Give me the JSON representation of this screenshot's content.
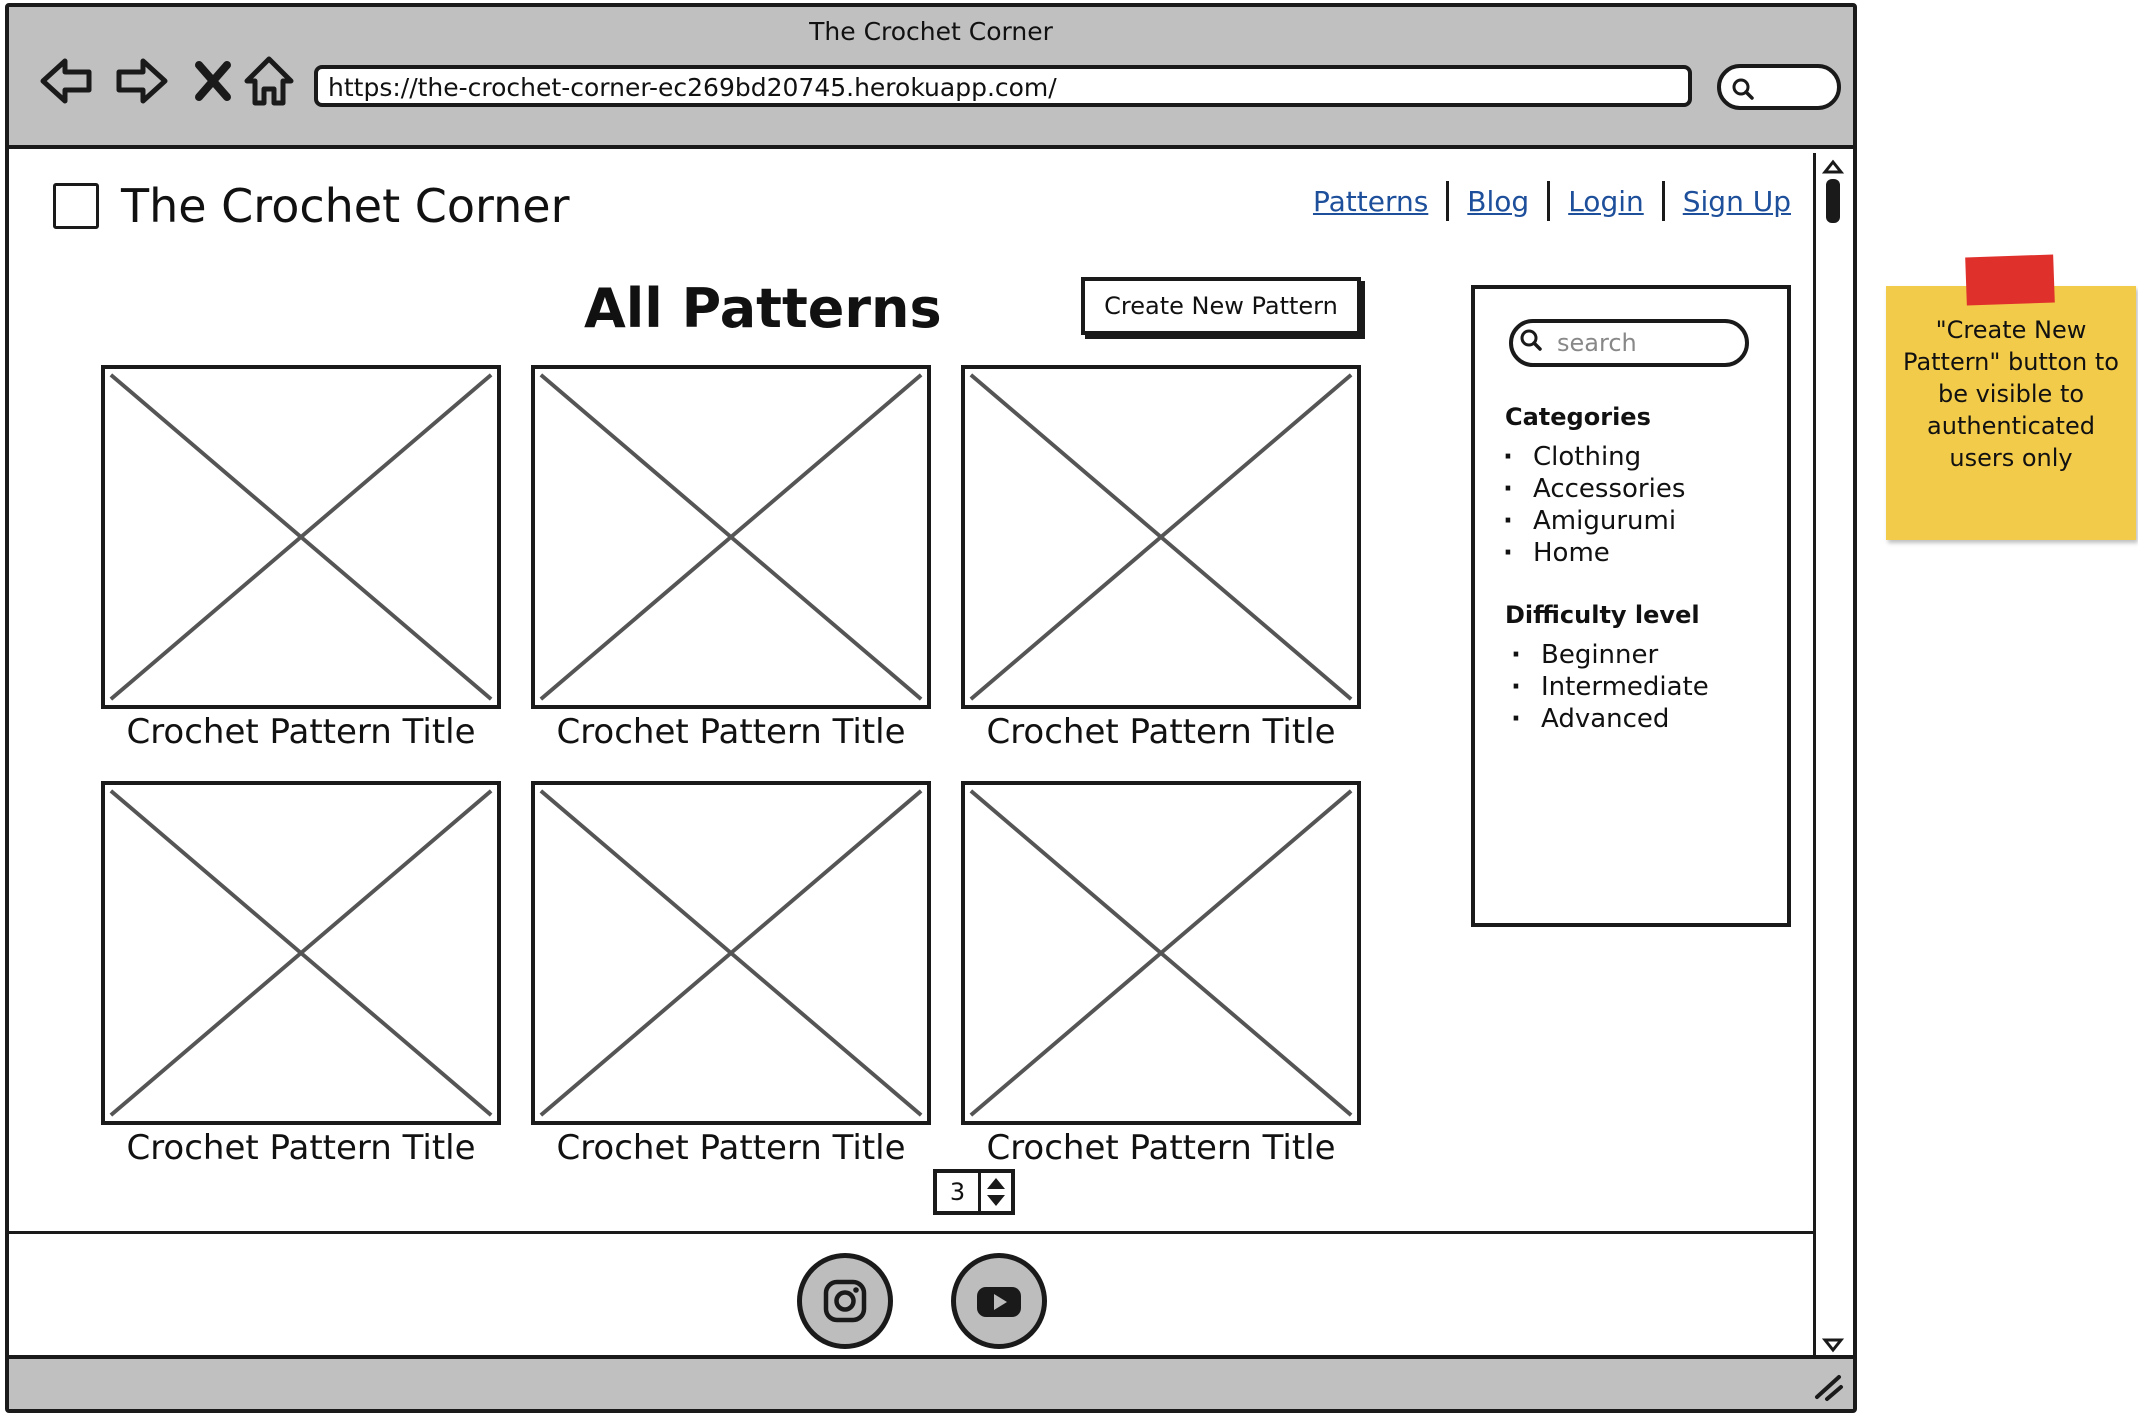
{
  "window": {
    "title": "The Crochet Corner",
    "url": "https://the-crochet-corner-ec269bd20745.herokuapp.com/"
  },
  "site": {
    "title": "The Crochet Corner"
  },
  "nav": {
    "items": [
      {
        "label": "Patterns"
      },
      {
        "label": "Blog"
      },
      {
        "label": "Login"
      },
      {
        "label": "Sign Up"
      }
    ]
  },
  "main": {
    "heading": "All Patterns",
    "create_button": "Create New Pattern",
    "cards": [
      {
        "title": "Crochet Pattern Title"
      },
      {
        "title": "Crochet Pattern Title"
      },
      {
        "title": "Crochet Pattern Title"
      },
      {
        "title": "Crochet Pattern Title"
      },
      {
        "title": "Crochet Pattern Title"
      },
      {
        "title": "Crochet Pattern Title"
      }
    ],
    "pagination_value": "3"
  },
  "sidebar": {
    "search_placeholder": "search",
    "categories_heading": "Categories",
    "categories": [
      "Clothing",
      "Accessories",
      "Amigurumi",
      "Home"
    ],
    "difficulty_heading": "Difficulty level",
    "difficulty": [
      "Beginner",
      "Intermediate",
      "Advanced"
    ]
  },
  "footer": {
    "social": [
      {
        "icon": "instagram-icon"
      },
      {
        "icon": "youtube-icon"
      }
    ]
  },
  "annotation": {
    "text": "\"Create New Pattern\" button to be visible to authenticated users only"
  },
  "colors": {
    "chrome": "#c0c0c0",
    "link": "#1d4f9b",
    "sticky": "#f3cb4a",
    "tape": "#e0302c"
  }
}
